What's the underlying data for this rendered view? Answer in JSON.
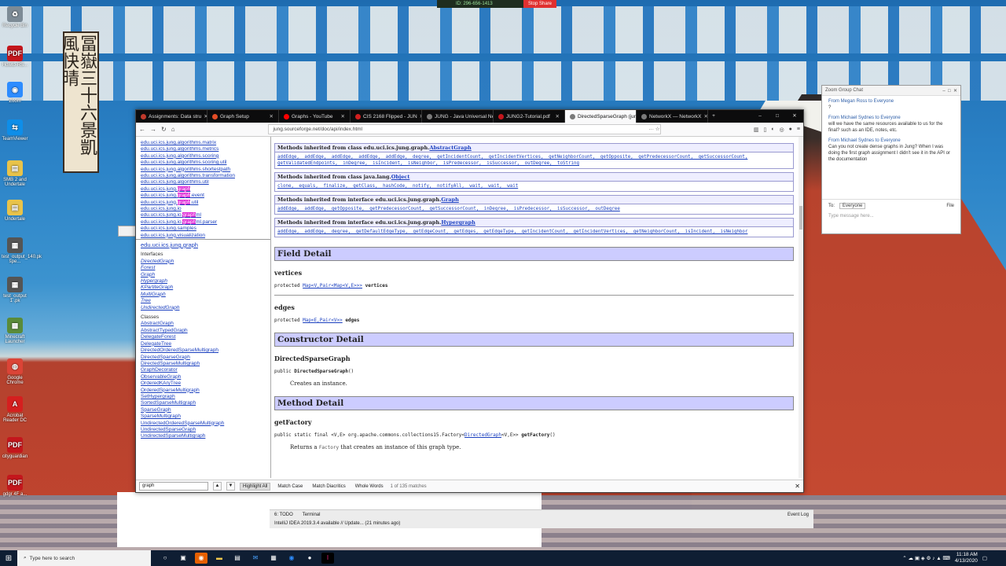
{
  "share_bar": {
    "meeting_id": "ID: 296-656-1413",
    "stop_label": "Stop Share"
  },
  "desktop_icons": [
    {
      "label": "Recycle Bin",
      "glyph": "♻",
      "color": "#7d8b96"
    },
    {
      "label": "Howto-RS...",
      "glyph": "PDF",
      "color": "#c4161c"
    },
    {
      "label": "Zoom",
      "glyph": "◉",
      "color": "#2d8cff"
    },
    {
      "label": "TeamViewer",
      "glyph": "⇆",
      "color": "#0e8ee9"
    },
    {
      "label": "SMB 2 and Undertale",
      "glyph": "▤",
      "color": "#e8c34a"
    },
    {
      "label": "Undertale",
      "glyph": "▤",
      "color": "#e8c34a"
    },
    {
      "label": "test_output_140.pk spe...",
      "glyph": "▦",
      "color": "#555"
    },
    {
      "label": "test_output 1 .pk",
      "glyph": "▦",
      "color": "#555"
    },
    {
      "label": "Minecraft Launcher",
      "glyph": "▩",
      "color": "#5a8b3a"
    },
    {
      "label": "Google Chrome",
      "glyph": "◍",
      "color": "#db4437"
    },
    {
      "label": "Acrobat Reader DC",
      "glyph": "A",
      "color": "#d51f1f"
    },
    {
      "label": "cityguardian",
      "glyph": "PDF",
      "color": "#c4161c"
    },
    {
      "label": "gdgr 4F a...",
      "glyph": "PDF",
      "color": "#c4161c"
    }
  ],
  "zoom_chat": {
    "title": "Zoom Group Chat",
    "messages": [
      {
        "from": "From Megan Ross to Everyone",
        "text": "?"
      },
      {
        "from": "From Michael Sydnes to Everyone",
        "text": "will we have the same resources available to us for the final? such as an IDE, notes, etc."
      },
      {
        "from": "From Michael Sydnes to Everyone",
        "text": "Can you not create dense graphs in Jung? When I was doing the first graph assignment I didn't see it in the API or the documentation"
      }
    ],
    "to_label": "To:",
    "to_value": "Everyone",
    "file_label": "File",
    "placeholder": "Type message here..."
  },
  "browser": {
    "tabs": [
      {
        "label": "Assignments: Data stru",
        "color": "#c0392b"
      },
      {
        "label": "Graph Setup",
        "color": "#e34c26"
      },
      {
        "label": "Graphs - YouTube",
        "color": "#ff0000"
      },
      {
        "label": "CIS 2168 Flipped - JUN",
        "color": "#d21f1f"
      },
      {
        "label": "JUNG - Java Universal Netw",
        "color": "#7a7a7a"
      },
      {
        "label": "JUNG2-Tutorial.pdf",
        "color": "#c4161c"
      },
      {
        "label": "DirectedSparseGraph (jung",
        "color": "#7a7a7a"
      },
      {
        "label": "NetworkX — NetworkX",
        "color": "#7a7a7a"
      }
    ],
    "url": "jung.sourceforge.net/doc/api/index.html",
    "packages": [
      {
        "pre": "edu.uci.ics.jung.algorithms.matrix",
        "hl": "",
        "post": ""
      },
      {
        "pre": "edu.uci.ics.jung.algorithms.metrics",
        "hl": "",
        "post": ""
      },
      {
        "pre": "edu.uci.ics.jung.algorithms.scoring",
        "hl": "",
        "post": ""
      },
      {
        "pre": "edu.uci.ics.jung.algorithms.scoring.util",
        "hl": "",
        "post": ""
      },
      {
        "pre": "edu.uci.ics.jung.algorithms.shortestpath",
        "hl": "",
        "post": ""
      },
      {
        "pre": "edu.uci.ics.jung.algorithms.transformation",
        "hl": "",
        "post": ""
      },
      {
        "pre": "edu.uci.ics.jung.algorithms.util",
        "hl": "",
        "post": ""
      },
      {
        "pre": "edu.uci.ics.jung.",
        "hl": "graph",
        "post": ""
      },
      {
        "pre": "edu.uci.ics.jung.",
        "hl": "graph",
        "post": ".event"
      },
      {
        "pre": "edu.uci.ics.jung.",
        "hl": "graph",
        "post": ".util"
      },
      {
        "pre": "edu.uci.ics.jung.io",
        "hl": "",
        "post": ""
      },
      {
        "pre": "edu.uci.ics.jung.io.",
        "hl": "graph",
        "post": "ml"
      },
      {
        "pre": "edu.uci.ics.jung.io.",
        "hl": "graph",
        "post": "ml.parser"
      },
      {
        "pre": "edu.uci.ics.jung.samples",
        "hl": "",
        "post": ""
      },
      {
        "pre": "edu.uci.ics.jung.visualization",
        "hl": "",
        "post": ""
      }
    ],
    "class_pkg": "edu.uci.ics.jung.graph",
    "interfaces_label": "Interfaces",
    "interfaces": [
      "DirectedGraph",
      "Forest",
      "Graph",
      "Hypergraph",
      "KPartiteGraph",
      "MultiGraph",
      "Tree",
      "UndirectedGraph"
    ],
    "classes_label": "Classes",
    "classes": [
      "AbstractGraph",
      "AbstractTypedGraph",
      "DelegateForest",
      "DelegateTree",
      "DirectedOrderedSparseMultigraph",
      "DirectedSparseGraph",
      "DirectedSparseMultigraph",
      "GraphDecorator",
      "ObservableGraph",
      "OrderedKAryTree",
      "OrderedSparseMultigraph",
      "SetHypergraph",
      "SortedSparseMultigraph",
      "SparseGraph",
      "SparseMultigraph",
      "UndirectedOrderedSparseMultigraph",
      "UndirectedSparseGraph",
      "UndirectedSparseMultigraph"
    ],
    "inherited": [
      {
        "head": "Methods inherited from class edu.uci.ics.jung.graph.",
        "link": "AbstractGraph",
        "body": "addEdge, addEdge, addEdge, addEdge, addEdge, degree, getIncidentCount, getIncidentVertices, getNeighborCount, getOpposite, getPredecessorCount, getSuccessorCount, getValidatedEndpoints, inDegree, isIncident, isNeighbor, isPredecessor, isSuccessor, outDegree, toString"
      },
      {
        "head": "Methods inherited from class java.lang.",
        "link": "Object",
        "body": "clone, equals, finalize, getClass, hashCode, notify, notifyAll, wait, wait, wait"
      },
      {
        "head": "Methods inherited from interface edu.uci.ics.jung.graph.",
        "link": "Graph",
        "body": "addEdge, addEdge, getOpposite, getPredecessorCount, getSuccessorCount, inDegree, isPredecessor, isSuccessor, outDegree"
      },
      {
        "head": "Methods inherited from interface edu.uci.ics.jung.graph.",
        "link": "Hypergraph",
        "body": "addEdge, addEdge, degree, getDefaultEdgeType, getEdgeCount, getEdges, getEdgeType, getIncidentCount, getIncidentVertices, getNeighborCount, isIncident, isNeighbor"
      }
    ],
    "field_detail": "Field Detail",
    "field1_name": "vertices",
    "field1_sig_a": "protected ",
    "field1_sig_b": "Map<V,Pair<Map<V,E>>>",
    "field1_sig_c": " vertices",
    "field2_name": "edges",
    "field2_sig_a": "protected ",
    "field2_sig_b": "Map<E,Pair<V>>",
    "field2_sig_c": " edges",
    "ctor_detail": "Constructor Detail",
    "ctor_name": "DirectedSparseGraph",
    "ctor_sig_a": "public ",
    "ctor_sig_b": "DirectedSparseGraph",
    "ctor_sig_c": "()",
    "ctor_desc": "Creates an instance.",
    "method_detail": "Method Detail",
    "method_name": "getFactory",
    "method_sig_a": "public static final <V,E> org.apache.commons.collections15.Factory<",
    "method_sig_b": "DirectedGraph",
    "method_sig_c": "<V,E>> ",
    "method_sig_d": "getFactory",
    "method_sig_e": "()",
    "method_desc_a": "Returns a ",
    "method_desc_code": "Factory",
    "method_desc_b": " that creates an instance of this graph type.",
    "find": {
      "value": "graph",
      "highlight_all": "Highlight All",
      "match_case": "Match Case",
      "match_diacritics": "Match Diacritics",
      "whole_words": "Whole Words",
      "count": "1 of 135 matches"
    }
  },
  "ide_status": {
    "todo": "6: TODO",
    "terminal": "Terminal",
    "event_log": "Event Log",
    "update": "IntelliJ IDEA 2019.3.4 available // Update... (21 minutes ago)"
  },
  "taskbar": {
    "search_placeholder": "Type here to search",
    "time": "11:18 AM",
    "date": "4/13/2020"
  }
}
